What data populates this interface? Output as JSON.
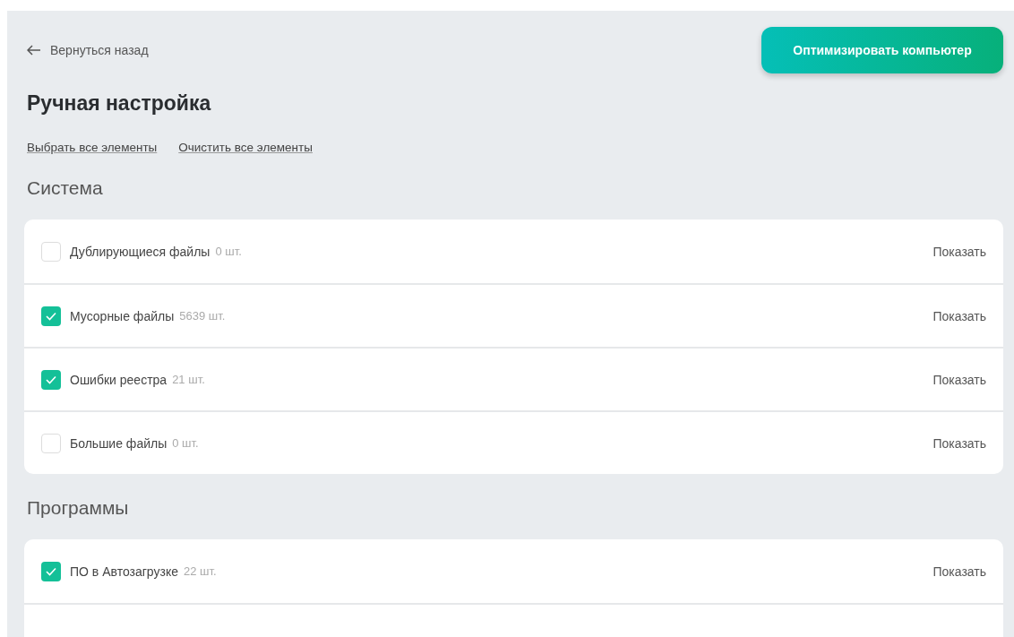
{
  "back_link": "Вернуться назад",
  "optimize_button": "Оптимизировать компьютер",
  "title": "Ручная настройка",
  "actions": [
    "Выбрать все элементы",
    "Очистить все элементы"
  ],
  "sections": [
    {
      "heading": "Система",
      "items": [
        {
          "label": "Дублирующиеся файлы",
          "count": "0 шт.",
          "checked": false,
          "action": "Показать"
        },
        {
          "label": "Мусорные файлы",
          "count": "5639 шт.",
          "checked": true,
          "action": "Показать"
        },
        {
          "label": "Ошибки реестра",
          "count": "21 шт.",
          "checked": true,
          "action": "Показать"
        },
        {
          "label": "Большие файлы",
          "count": "0 шт.",
          "checked": false,
          "action": "Показать"
        }
      ]
    },
    {
      "heading": "Программы",
      "items": [
        {
          "label": "ПО в Автозагрузке",
          "count": "22 шт.",
          "checked": true,
          "action": "Показать"
        }
      ]
    }
  ]
}
